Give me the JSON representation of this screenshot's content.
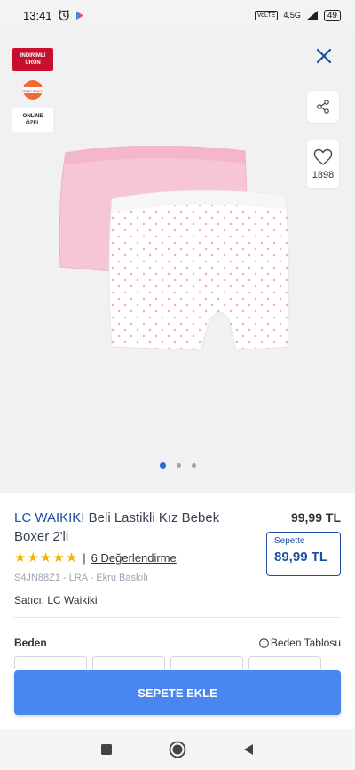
{
  "status_bar": {
    "time": "13:41",
    "network": "4.5G",
    "network_box": "VoLTE",
    "battery": "49"
  },
  "gallery": {
    "badges": {
      "discount": "İNDİRİMLİ\nÜRÜN",
      "kupon": "Süper Kupon",
      "online": "ONLINE\nÖZEL"
    },
    "favorite_count": "1898",
    "dots": 3,
    "active_dot": 0
  },
  "product": {
    "brand": "LC WAIKIKI",
    "name": "Beli Lastikli Kız Bebek Boxer 2'li",
    "price": "99,99 TL",
    "basket_label": "Sepette",
    "basket_price": "89,99 TL",
    "rating": 5,
    "review_separator": "|",
    "review_text": "6 Değerlendirme",
    "sku": "S4JN88Z1 - LRA - Ekru Baskılı",
    "seller": "Satıcı: LC Waikiki"
  },
  "size": {
    "title": "Beden",
    "table_label": "Beden Tablosu"
  },
  "actions": {
    "add_to_cart": "SEPETE EKLE"
  },
  "colors": {
    "brand_blue": "#1f4fa3",
    "cta_blue": "#4a86f0",
    "star": "#f5b400",
    "badge_red": "#c8102e"
  }
}
